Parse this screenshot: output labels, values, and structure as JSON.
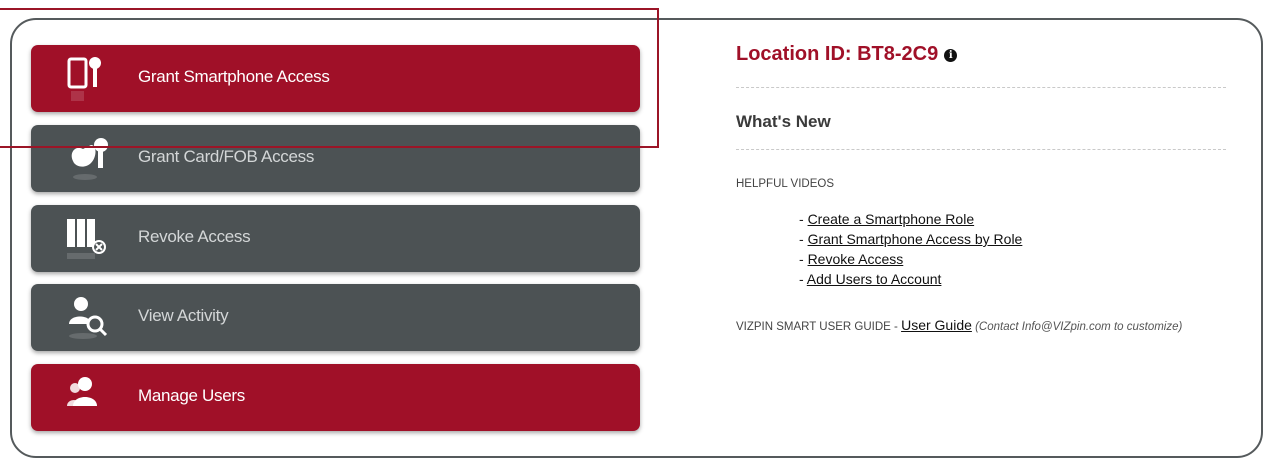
{
  "actions": {
    "grant_smartphone": "Grant Smartphone Access",
    "grant_card": "Grant Card/FOB Access",
    "revoke": "Revoke Access",
    "view_activity": "View Activity",
    "manage_users": "Manage Users"
  },
  "location": {
    "title": "Location ID: BT8-2C9",
    "info_icon": "info-icon"
  },
  "whats_new": {
    "heading": "What's New"
  },
  "helpful_videos": {
    "heading": "HELPFUL VIDEOS",
    "items": [
      "Create a Smartphone Role",
      "Grant Smartphone Access by Role",
      "Revoke Access",
      "Add Users to Account"
    ]
  },
  "guide": {
    "prefix": "VIZPIN SMART USER GUIDE - ",
    "link": "User Guide",
    "note": "(Contact Info@VIZpin.com to customize)"
  },
  "colors": {
    "brand_red": "#a01028",
    "button_gray": "#4c5254",
    "frame": "#555a5c"
  }
}
